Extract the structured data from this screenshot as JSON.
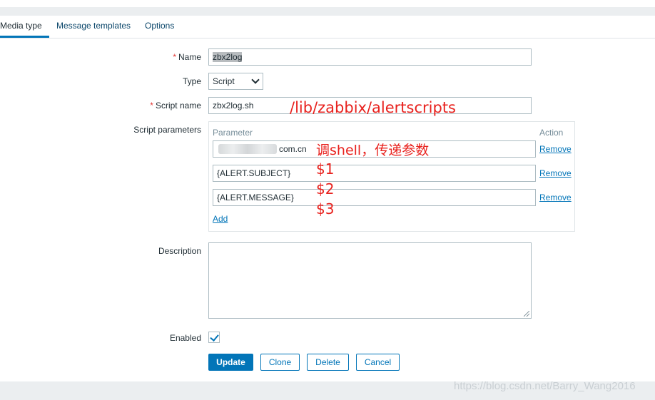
{
  "tabs": {
    "media_type": "Media type",
    "message_templates": "Message templates",
    "options": "Options"
  },
  "form": {
    "required_mark": "*",
    "name_label": "Name",
    "name_value": "zbx2log",
    "type_label": "Type",
    "type_value": "Script",
    "script_name_label": "Script name",
    "script_name_value": "zbx2log.sh",
    "script_params_label": "Script parameters",
    "params_header_parameter": "Parameter",
    "params_header_action": "Action",
    "params": [
      {
        "value": "com.cn",
        "remove": "Remove"
      },
      {
        "value": "{ALERT.SUBJECT}",
        "remove": "Remove"
      },
      {
        "value": "{ALERT.MESSAGE}",
        "remove": "Remove"
      }
    ],
    "add_label": "Add",
    "description_label": "Description",
    "enabled_label": "Enabled",
    "enabled_checked": true
  },
  "buttons": {
    "update": "Update",
    "clone": "Clone",
    "delete": "Delete",
    "cancel": "Cancel"
  },
  "annotations": {
    "path": "/lib/zabbix/alertscripts",
    "shell_note": "调shell，传递参数",
    "p1": "$1",
    "p2": "$2",
    "p3": "$3"
  },
  "watermark": "https://blog.csdn.net/Barry_Wang2016",
  "colors": {
    "accent": "#0275b8",
    "annotation": "#e8211d",
    "required": "#e33734"
  }
}
